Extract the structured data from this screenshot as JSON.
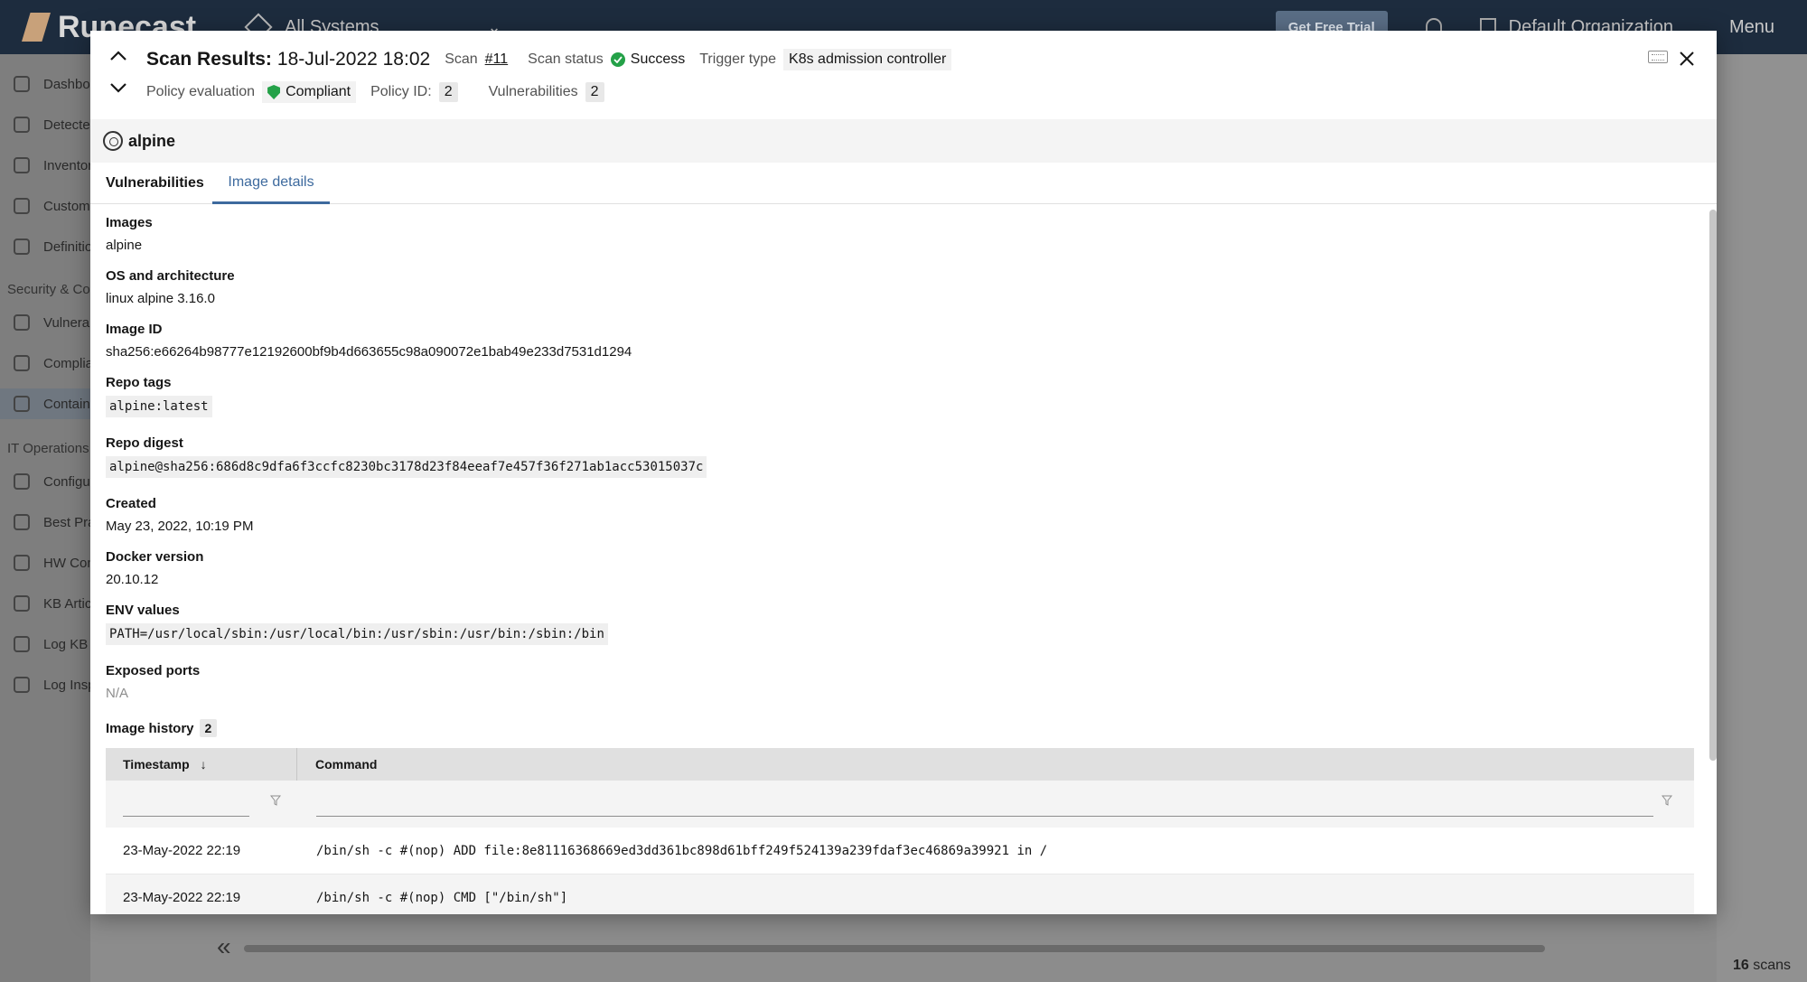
{
  "app": {
    "logo_text": "Runecast",
    "systems_selector": "All Systems",
    "trial_button": "Get Free Trial",
    "organization": "Default Organization",
    "menu_label": "Menu"
  },
  "sidebar": {
    "items": [
      {
        "label": "Dashboard"
      },
      {
        "label": "Detected issues"
      },
      {
        "label": "Inventory"
      },
      {
        "label": "Custom profiles"
      },
      {
        "label": "Definitions"
      },
      {
        "label": "Vulnerabilities"
      },
      {
        "label": "Compliance"
      },
      {
        "label": "Containers"
      },
      {
        "label": "Configuration"
      },
      {
        "label": "Best Practices"
      },
      {
        "label": "HW Compatibility"
      },
      {
        "label": "KB Articles"
      },
      {
        "label": "Log KB Articles"
      },
      {
        "label": "Log Inspector"
      }
    ],
    "sections": [
      "Security & Compliance",
      "IT Operations"
    ]
  },
  "footer": {
    "scans_count": "16",
    "scans_label": "scans"
  },
  "modal": {
    "title": "Scan Results:",
    "date": "18-Jul-2022 18:02",
    "scan_label": "Scan",
    "scan_link": "#11",
    "scan_status_label": "Scan status",
    "scan_status": "Success",
    "trigger_type_label": "Trigger type",
    "trigger_type": "K8s admission controller",
    "policy_eval_label": "Policy evaluation",
    "policy_eval": "Compliant",
    "policy_id_label": "Policy ID:",
    "policy_id": "2",
    "vulns_label": "Vulnerabilities",
    "vulns_count": "2",
    "image_name": "alpine",
    "tabs": [
      {
        "label": "Vulnerabilities"
      },
      {
        "label": "Image details"
      }
    ],
    "details": {
      "images_label": "Images",
      "images": "alpine",
      "os_label": "OS and architecture",
      "os": "linux alpine 3.16.0",
      "image_id_label": "Image ID",
      "image_id": "sha256:e66264b98777e12192600bf9b4d663655c98a090072e1bab49e233d7531d1294",
      "repo_tags_label": "Repo tags",
      "repo_tags": "alpine:latest",
      "repo_digest_label": "Repo digest",
      "repo_digest": "alpine@sha256:686d8c9dfa6f3ccfc8230bc3178d23f84eeaf7e457f36f271ab1acc53015037c",
      "created_label": "Created",
      "created": "May 23, 2022, 10:19 PM",
      "docker_label": "Docker version",
      "docker": "20.10.12",
      "env_label": "ENV values",
      "env": "PATH=/usr/local/sbin:/usr/local/bin:/usr/sbin:/usr/bin:/sbin:/bin",
      "ports_label": "Exposed ports",
      "ports": "N/A",
      "history_label": "Image history",
      "history_count": "2"
    },
    "history_table": {
      "columns": [
        "Timestamp",
        "Command"
      ],
      "rows": [
        {
          "timestamp": "23-May-2022 22:19",
          "command": "/bin/sh -c #(nop) ADD file:8e81116368669ed3dd361bc898d61bff249f524139a239fdaf3ec46869a39921 in /"
        },
        {
          "timestamp": "23-May-2022 22:19",
          "command": "/bin/sh -c #(nop) CMD [\"/bin/sh\"]"
        }
      ]
    }
  }
}
